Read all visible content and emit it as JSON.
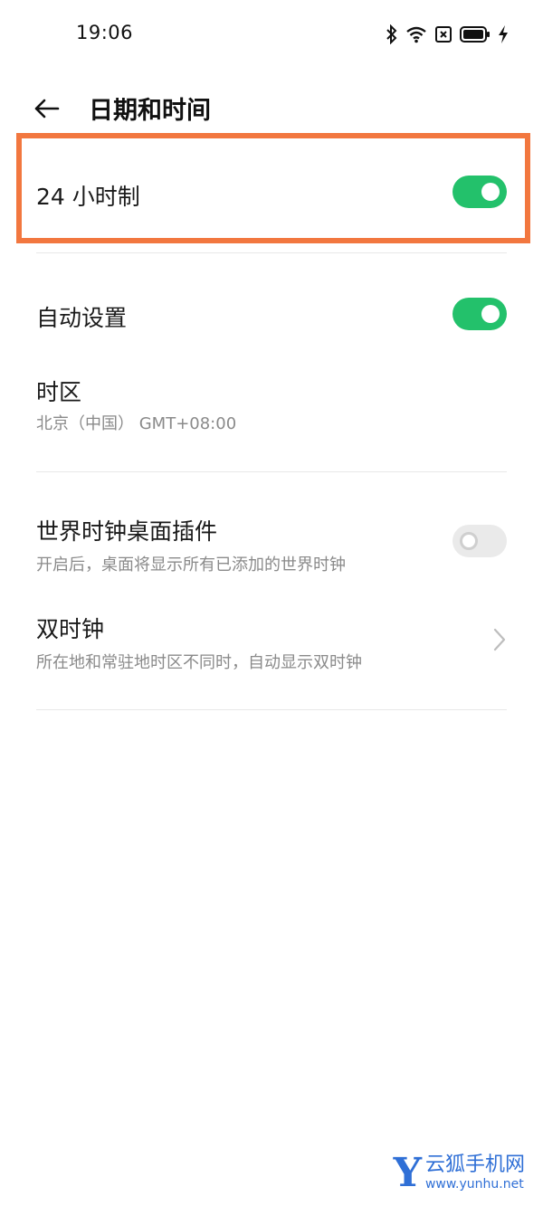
{
  "status_bar": {
    "time": "19:06",
    "icons": [
      "bluetooth-icon",
      "wifi-icon",
      "sim-off-icon",
      "battery-icon",
      "charging-icon"
    ]
  },
  "header": {
    "title": "日期和时间",
    "back_icon": "arrow-left-icon"
  },
  "settings": {
    "hour24": {
      "label": "24 小时制",
      "enabled": true
    },
    "auto_set": {
      "label": "自动设置",
      "enabled": true
    },
    "timezone": {
      "label": "时区",
      "value": "北京（中国） GMT+08:00"
    },
    "world_clock_widget": {
      "label": "世界时钟桌面插件",
      "description": "开启后，桌面将显示所有已添加的世界时钟",
      "enabled": false
    },
    "dual_clock": {
      "label": "双时钟",
      "description": "所在地和常驻地时区不同时，自动显示双时钟"
    }
  },
  "colors": {
    "toggle_on": "#23c16b",
    "toggle_off": "#eaeaea",
    "highlight": "#f2773f"
  },
  "watermark": {
    "logo": "Y",
    "title": "云狐手机网",
    "url": "www.yunhu.net"
  }
}
